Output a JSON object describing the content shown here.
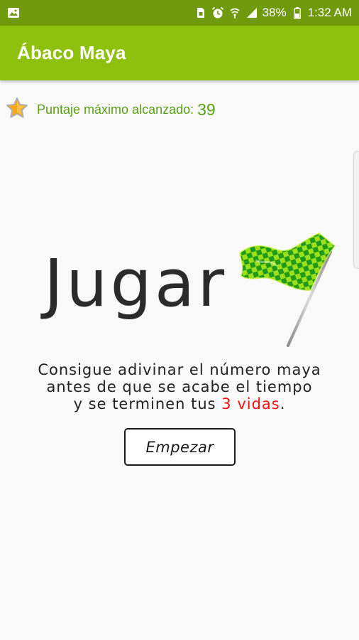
{
  "status_bar": {
    "battery": "38%",
    "time": "1:32 AM",
    "icons": [
      "gallery-icon",
      "sim-icon",
      "alarm-icon",
      "wifi-icon",
      "signal-icon",
      "battery-icon"
    ]
  },
  "app_bar": {
    "title": "Ábaco Maya"
  },
  "score": {
    "label": "Puntaje máximo alcanzado:",
    "value": "39",
    "icon": "star-icon"
  },
  "main": {
    "heading": "Jugar",
    "flag_icon": "checkered-flag-icon",
    "description_line1": "Consigue adivinar el número maya",
    "description_line2": "antes de que se acabe el tiempo",
    "description_line3_prefix": "y se terminen tus ",
    "description_lives": "3 vidas",
    "description_line3_suffix": ".",
    "start_button": "Empezar"
  },
  "colors": {
    "status_bar": "#6f9a0b",
    "app_bar": "#8dc10d",
    "score_text": "#5a9e16",
    "lives_text": "#ff1010"
  }
}
